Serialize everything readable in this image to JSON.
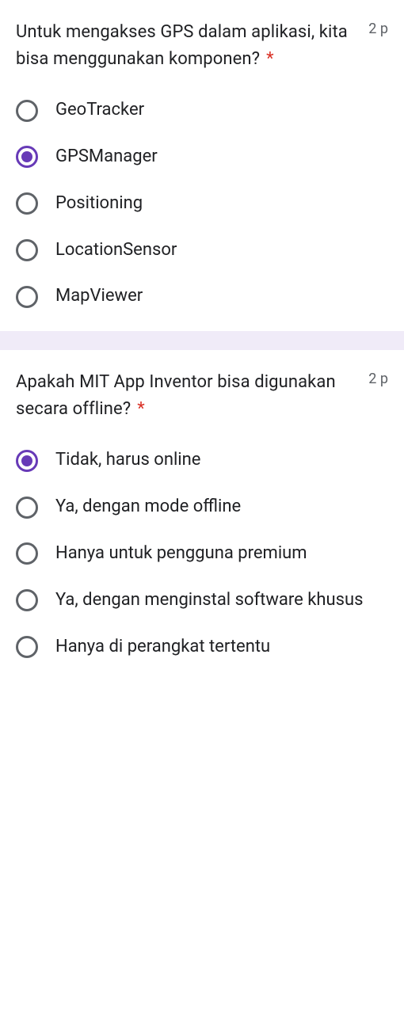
{
  "questions": [
    {
      "text": "Untuk mengakses GPS dalam aplikasi, kita bisa menggunakan komponen?",
      "required": "*",
      "points": "2 p",
      "options": [
        {
          "label": "GeoTracker",
          "selected": false
        },
        {
          "label": "GPSManager",
          "selected": true
        },
        {
          "label": "Positioning",
          "selected": false
        },
        {
          "label": "LocationSensor",
          "selected": false
        },
        {
          "label": "MapViewer",
          "selected": false
        }
      ]
    },
    {
      "text": "Apakah MIT App Inventor bisa digunakan secara offline?",
      "required": "*",
      "points": "2 p",
      "options": [
        {
          "label": "Tidak, harus online",
          "selected": true
        },
        {
          "label": "Ya, dengan mode offline",
          "selected": false
        },
        {
          "label": "Hanya untuk pengguna premium",
          "selected": false
        },
        {
          "label": "Ya, dengan menginstal software khusus",
          "selected": false
        },
        {
          "label": "Hanya di perangkat tertentu",
          "selected": false
        }
      ]
    }
  ]
}
